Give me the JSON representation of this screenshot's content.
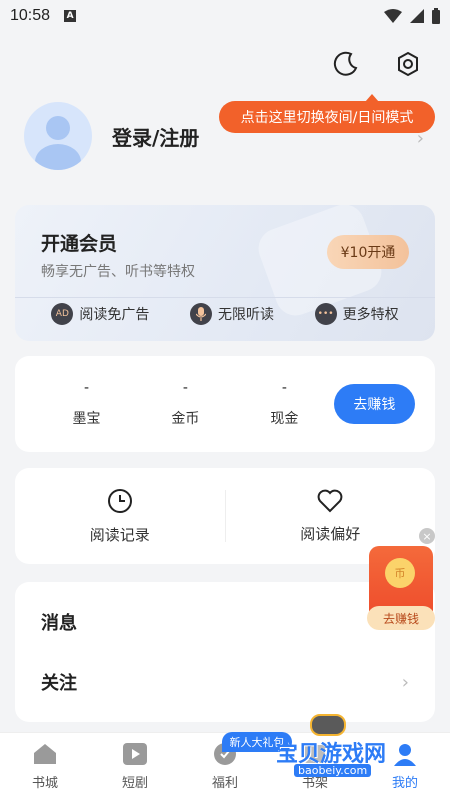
{
  "status_bar": {
    "time": "10:58",
    "a_icon": "A"
  },
  "tooltip": {
    "text": "点击这里切换夜间/日间模式"
  },
  "profile": {
    "login_text": "登录/注册"
  },
  "vip": {
    "title": "开通会员",
    "subtitle": "畅享无广告、听书等特权",
    "button": "¥10开通",
    "perks": [
      {
        "icon": "AD",
        "label": "阅读免广告"
      },
      {
        "icon": "mic-icon",
        "label": "无限听读"
      },
      {
        "icon": "more-icon",
        "label": "更多特权"
      }
    ]
  },
  "wallet": {
    "items": [
      {
        "value": "-",
        "label": "墨宝"
      },
      {
        "value": "-",
        "label": "金币"
      },
      {
        "value": "-",
        "label": "现金"
      }
    ],
    "earn_button": "去赚钱"
  },
  "quick": {
    "history": "阅读记录",
    "preference": "阅读偏好"
  },
  "list": {
    "messages": "消息",
    "follow": "关注"
  },
  "float_widget": {
    "coin": "币",
    "label": "去赚钱"
  },
  "tabbar": {
    "gift_badge": "新人大礼包",
    "tabs": [
      {
        "label": "书城"
      },
      {
        "label": "短剧"
      },
      {
        "label": "福利"
      },
      {
        "label": "书架"
      },
      {
        "label": "我的"
      }
    ]
  },
  "watermark": {
    "text": "宝贝游戏网",
    "url": "baobeiy.com"
  },
  "colors": {
    "accent": "#2d7cf6",
    "tooltip": "#f2612a",
    "vip_button": "#f3c29b"
  }
}
